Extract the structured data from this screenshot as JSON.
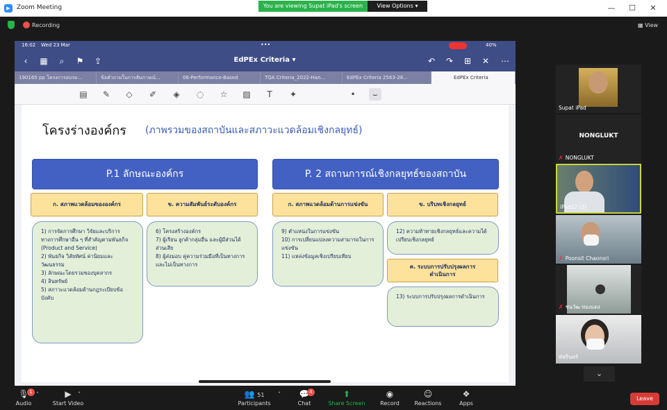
{
  "window": {
    "title": "Zoom Meeting",
    "share_banner": "You are viewing Supat iPad's screen",
    "view_options": "View Options"
  },
  "status": {
    "recording": "Recording",
    "view": "View"
  },
  "ipad": {
    "time": "16:02",
    "date": "Wed 23 Mar",
    "battery": "40%",
    "doc_title": "EdPEx Criteria"
  },
  "tabs": [
    "190165 pp โครงการอบรม...",
    "ข้อคำถามในการสัมภาษณ์...",
    "06-Performance-Based",
    "TQA Criteria_2022-Han...",
    "EdPEx Criteria 2563-28...",
    "EdPEx Criteria"
  ],
  "slide": {
    "title": "โครงร่างองค์กร",
    "subtitle": "(ภาพรวมของสถาบันและสภาวะแวดล้อมเชิงกลยุทธ์)",
    "p1": {
      "header": "P.1 ลักษณะองค์กร",
      "a_label": "ก. สภาพแวดล้อมขององค์กร",
      "a_items": "1) การจัดการศึกษา วิจัยและบริการทางการศึกษาอื่น ๆ ที่สำคัญตามพันธกิจ (Product and Service)\n2) พันธกิจ วิสัยทัศน์ ค่านิยมและวัฒนธรรม\n3) ลักษณะโดยรวมของบุคลากร\n4) สินทรัพย์\n5) สภาวะแวดล้อมด้านกฎระเบียบข้อบังคับ",
      "b_label": "ข. ความสัมพันธ์ระดับองค์กร",
      "b_items": "6) โครงสร้างองค์กร\n7) ผู้เรียน ลูกค้ากลุ่มอื่น และผู้มีส่วนได้ส่วนเสีย\n8) ผู้ส่งมอบ คู่ความร่วมมือที่เป็นทางการและไม่เป็นทางการ"
    },
    "p2": {
      "header": "P. 2 สถานการณ์เชิงกลยุทธ์ของสถาบัน",
      "a_label": "ก. สภาพแวดล้อมด้านการแข่งขัน",
      "a_items": "9) ตำแหน่งในการแข่งขัน\n10) การเปลี่ยนแปลงความสามารถในการแข่งขัน\n11) แหล่งข้อมูลเชิงเปรียบเทียบ",
      "b_label": "ข. บริบทเชิงกลยุทธ์",
      "b_items": "12) ความท้าทายเชิงกลยุทธ์และความได้เปรียบเชิงกลยุทธ์",
      "c_label": "ค. ระบบการปรับปรุงผลการดำเนินการ",
      "c_items": "13) ระบบการปรับปรุงผลการดำเนินการ"
    }
  },
  "participants": [
    {
      "name": "Supat iPad",
      "muted": false
    },
    {
      "name": "NONGLUKT",
      "muted": true,
      "label": "NONGLUKT"
    },
    {
      "name": "iPad12 (2)",
      "muted": false
    },
    {
      "name": "Poonsit Chaonsri",
      "muted": true
    },
    {
      "name": "ชนวัฒ ทองแดง",
      "muted": true
    },
    {
      "name": "พัชรินทร์",
      "muted": false
    }
  ],
  "controls": {
    "audio": "Audio",
    "video": "Start Video",
    "participants": "Participants",
    "participants_count": "51",
    "chat": "Chat",
    "chat_badge": "4",
    "share": "Share Screen",
    "record": "Record",
    "reactions": "Reactions",
    "apps": "Apps",
    "leave": "Leave",
    "audio_badge": "1"
  },
  "colors": {
    "share_green": "#2bb24c",
    "ipad_header": "#3f4d86",
    "slide_blue": "#4361c2",
    "slide_yellow": "#fce29a",
    "slide_green": "#e3efd8",
    "leave_red": "#d83b36"
  }
}
